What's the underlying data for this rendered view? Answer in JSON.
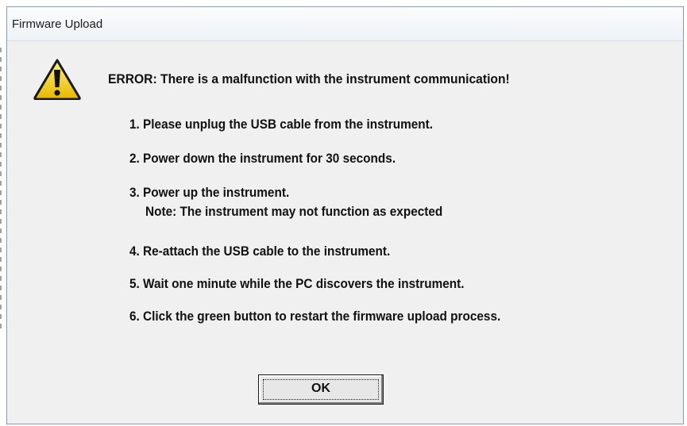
{
  "window": {
    "title": "Firmware Upload"
  },
  "icons": {
    "warning": "warning-icon"
  },
  "dialog": {
    "error_heading": "ERROR: There is a malfunction with the instrument communication!",
    "steps": [
      "1. Please unplug the USB cable from the instrument.",
      "2. Power down the instrument for 30 seconds.",
      "3. Power up the instrument.",
      "4. Re-attach the USB cable to the instrument.",
      "5. Wait one minute while the PC discovers the instrument.",
      "6. Click the green button to restart the firmware upload process."
    ],
    "note": "Note: The instrument may not function as expected",
    "ok_label": "OK"
  },
  "colors": {
    "warning_fill": "#f6d22a",
    "warning_border": "#1a1a1a",
    "dialog_background": "#f0f0f0"
  }
}
